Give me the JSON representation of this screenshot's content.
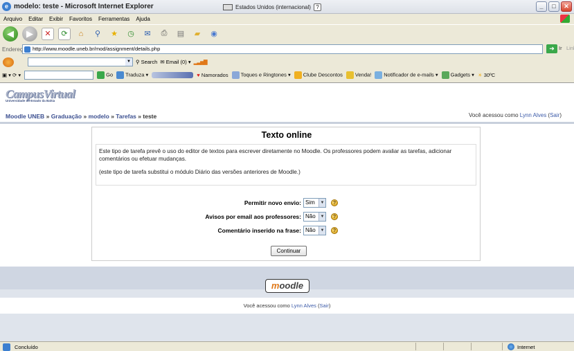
{
  "window": {
    "title": "modelo: teste - Microsoft Internet Explorer",
    "keyboard_layout": "Estados Unidos (internacional)",
    "help_glyph": "?",
    "min_label": "_",
    "max_label": "□",
    "close_label": "✕"
  },
  "menu": [
    "Arquivo",
    "Editar",
    "Exibir",
    "Favoritos",
    "Ferramentas",
    "Ajuda"
  ],
  "address": {
    "label": "Endereço",
    "url": "http://www.moodle.uneb.br/mod/assignment/details.php",
    "go_label": "Ir",
    "links_label": "Links"
  },
  "searchbar": {
    "search_label": "Search",
    "email_label": "Email (0)"
  },
  "linksbar": {
    "go_label": "Go",
    "translate_label": "Traduza",
    "items": [
      "Namorados",
      "Toques e Ringtones",
      "Clube Descontos",
      "Venda!",
      "Notificador de e-mails",
      "Gadgets",
      "30ºC"
    ]
  },
  "page": {
    "logo_text": "CampusVirtual",
    "logo_subtitle": "Universidade do Estado da Bahia",
    "breadcrumb": [
      "Moodle UNEB",
      "Graduação",
      "modelo",
      "Tarefas",
      "teste"
    ],
    "breadcrumb_sep": "»",
    "login_prefix": "Você acessou como",
    "user_name": "Lynn Alves",
    "logout_label": "Sair"
  },
  "assignment": {
    "heading": "Texto online",
    "description_1": "Este tipo de tarefa prevê o uso do editor de textos para escrever diretamente no Moodle. Os professores podem avaliar as tarefas, adicionar comentários ou efetuar mudanças.",
    "description_2": "(este tipo de tarefa substitui o módulo Diário das versões anteriores de Moodle.)",
    "fields": [
      {
        "label": "Permitir novo envio:",
        "value": "Sim"
      },
      {
        "label": "Avisos por email aos professores:",
        "value": "Não"
      },
      {
        "label": "Comentário inserido na frase:",
        "value": "Não"
      }
    ],
    "help_glyph": "?",
    "continue_label": "Continuar"
  },
  "footer": {
    "moodle_m": "m",
    "moodle_rest": "oodle"
  },
  "status": {
    "left": "Concluído",
    "right": "Internet"
  }
}
